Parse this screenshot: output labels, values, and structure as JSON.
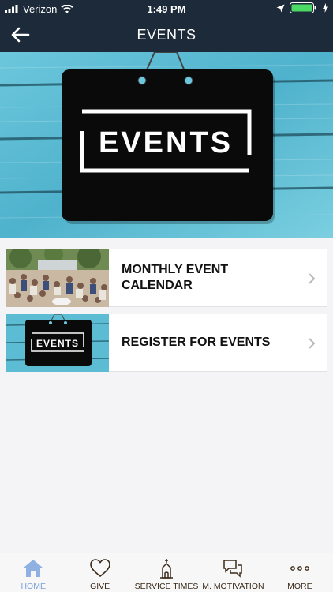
{
  "status_bar": {
    "carrier": "Verizon",
    "time": "1:49 PM"
  },
  "header": {
    "title": "EVENTS"
  },
  "hero": {
    "sign_text": "EVENTS"
  },
  "list": {
    "items": [
      {
        "label": "MONTHLY EVENT CALENDAR"
      },
      {
        "label": "REGISTER FOR EVENTS",
        "thumb_sign_text": "EVENTS"
      }
    ]
  },
  "tabbar": {
    "tabs": [
      {
        "label": "HOME",
        "icon": "home-icon",
        "active": true
      },
      {
        "label": "GIVE",
        "icon": "heart-icon"
      },
      {
        "label": "SERVICE TIMES",
        "icon": "church-icon"
      },
      {
        "label": "M. MOTIVATION",
        "icon": "chat-icon"
      },
      {
        "label": "MORE",
        "icon": "more-icon"
      }
    ]
  },
  "colors": {
    "header_bg": "#1c2a3a",
    "active_tab": "#7aa0d8",
    "wood_blue": "#4fb6cf"
  }
}
